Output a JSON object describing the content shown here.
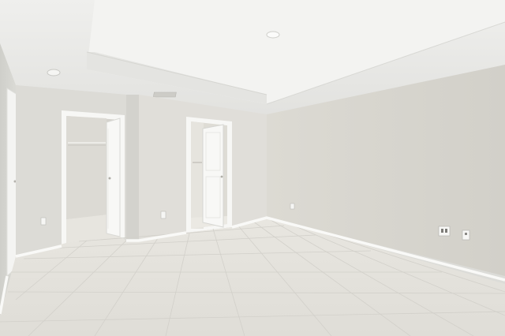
{
  "scene": {
    "description_free": true,
    "watermark_text": "",
    "colors": {
      "ceiling": "#ebebea",
      "ceiling_tray": "#f4f4f2",
      "wall_left": "#d9d9d4",
      "wall_back": "#dedcd6",
      "wall_right": "#d8d6cf",
      "floor": "#e6e4de",
      "trim": "#f8f8f6",
      "door": "#f7f7f5",
      "closet_interior": "#d6d3cd",
      "grout": "#cfcdc7"
    }
  }
}
